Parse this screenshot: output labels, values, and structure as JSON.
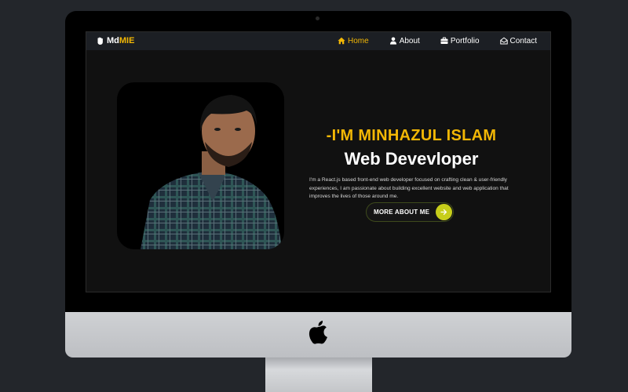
{
  "brand": {
    "prefix": "Md",
    "accent": "MIE"
  },
  "nav": {
    "items": [
      {
        "label": "Home",
        "icon": "home-icon",
        "active": true
      },
      {
        "label": "About",
        "icon": "user-icon",
        "active": false
      },
      {
        "label": "Portfolio",
        "icon": "briefcase-icon",
        "active": false
      },
      {
        "label": "Contact",
        "icon": "envelope-open-icon",
        "active": false
      }
    ]
  },
  "hero": {
    "greeting": "-I'M MINHAZUL ISLAM",
    "role": "Web Devevloper",
    "bio": "I'm a React.js based front-end web developer focused on crafting clean & user-friendly experiences, I am passionate about building excellent website and web application that improves the lives of those around me.",
    "cta_label": "MORE ABOUT ME"
  },
  "colors": {
    "accent": "#f2b705",
    "cta_button": "#c7ce1a",
    "screen_bg": "#111111",
    "navbar_bg": "#1c1f24",
    "page_bg": "#23262b"
  }
}
